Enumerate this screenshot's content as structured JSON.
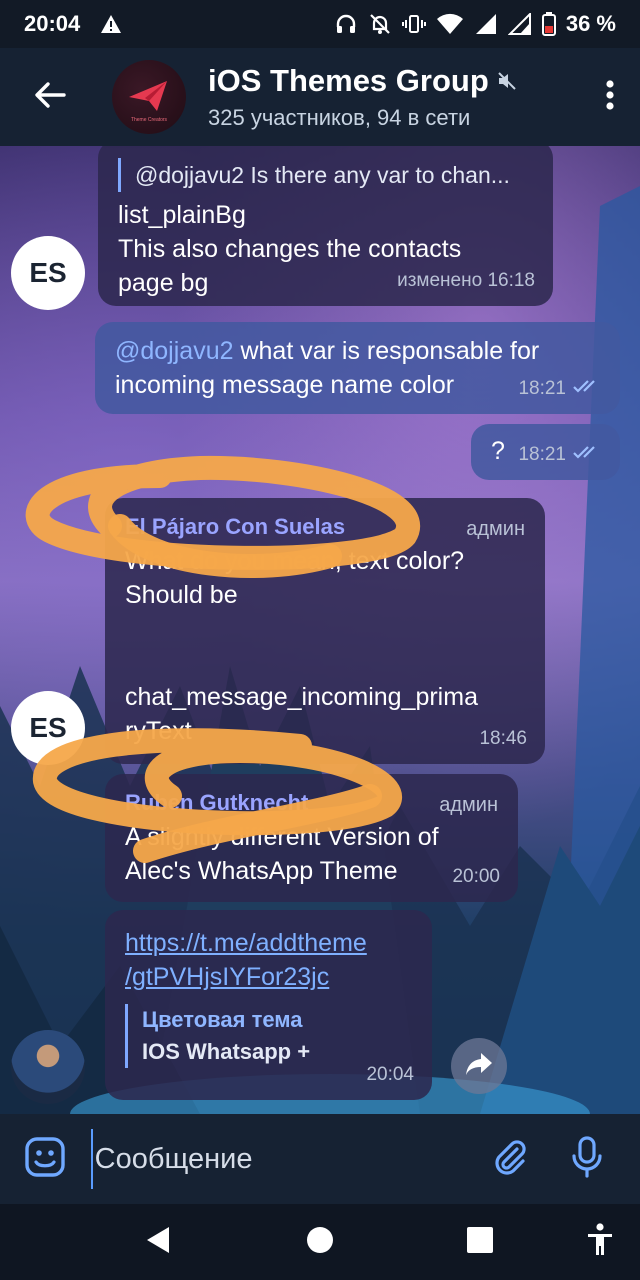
{
  "status_bar": {
    "time": "20:04",
    "battery": "36 %"
  },
  "header": {
    "title": "iOS Themes Group",
    "subtitle": "325 участников, 94 в сети",
    "avatar_caption": "Theme Creators"
  },
  "messages": [
    {
      "avatar": "ES",
      "reply_preview": "@dojjavu2 Is there any var to chan...",
      "text_lines": [
        "list_plainBg",
        "This also changes the contacts",
        "page bg"
      ],
      "meta": "изменено 16:18"
    },
    {
      "mention": "@dojjavu2",
      "text_line1": " what var is responsable for",
      "text_line2": "incoming message name color",
      "time": "18:21"
    },
    {
      "text": "?",
      "time": "18:21"
    },
    {
      "avatar": "ES",
      "sender": "El Pájaro Con Suelas",
      "role": "админ",
      "text_lines": [
        "What do you mean, text color?",
        "Should be",
        "",
        "",
        "chat_message_incoming_prima",
        "ryText"
      ],
      "time": "18:46"
    },
    {
      "sender": "Ruben Gutknecht",
      "role": "админ",
      "text_lines": [
        "A slightly different Version of",
        "Alec's WhatsApp Theme"
      ],
      "time": "20:00"
    },
    {
      "link_lines": [
        "https://t.me/addtheme",
        "/gtPVHjsIYFor23jc"
      ],
      "attachment_title": "Цветовая тема",
      "attachment_name": "IOS Whatsapp +",
      "time": "20:04"
    }
  ],
  "input": {
    "placeholder": "Сообщение"
  },
  "colors": {
    "highlight_scribble": "#f5a84a",
    "link": "#7fb0ff",
    "read_checks": "#9fc0ff"
  },
  "icons": {
    "status": [
      "alert-icon",
      "headphones-icon",
      "bell-off-icon",
      "vibrate-icon",
      "wifi-icon",
      "signal-icon",
      "battery-icon"
    ],
    "header": [
      "back-arrow-icon",
      "mute-icon",
      "more-vertical-icon"
    ],
    "input": [
      "emoji-icon",
      "attach-icon",
      "mic-icon"
    ],
    "nav": [
      "back-triangle-icon",
      "home-circle-icon",
      "recents-square-icon",
      "accessibility-icon"
    ]
  }
}
